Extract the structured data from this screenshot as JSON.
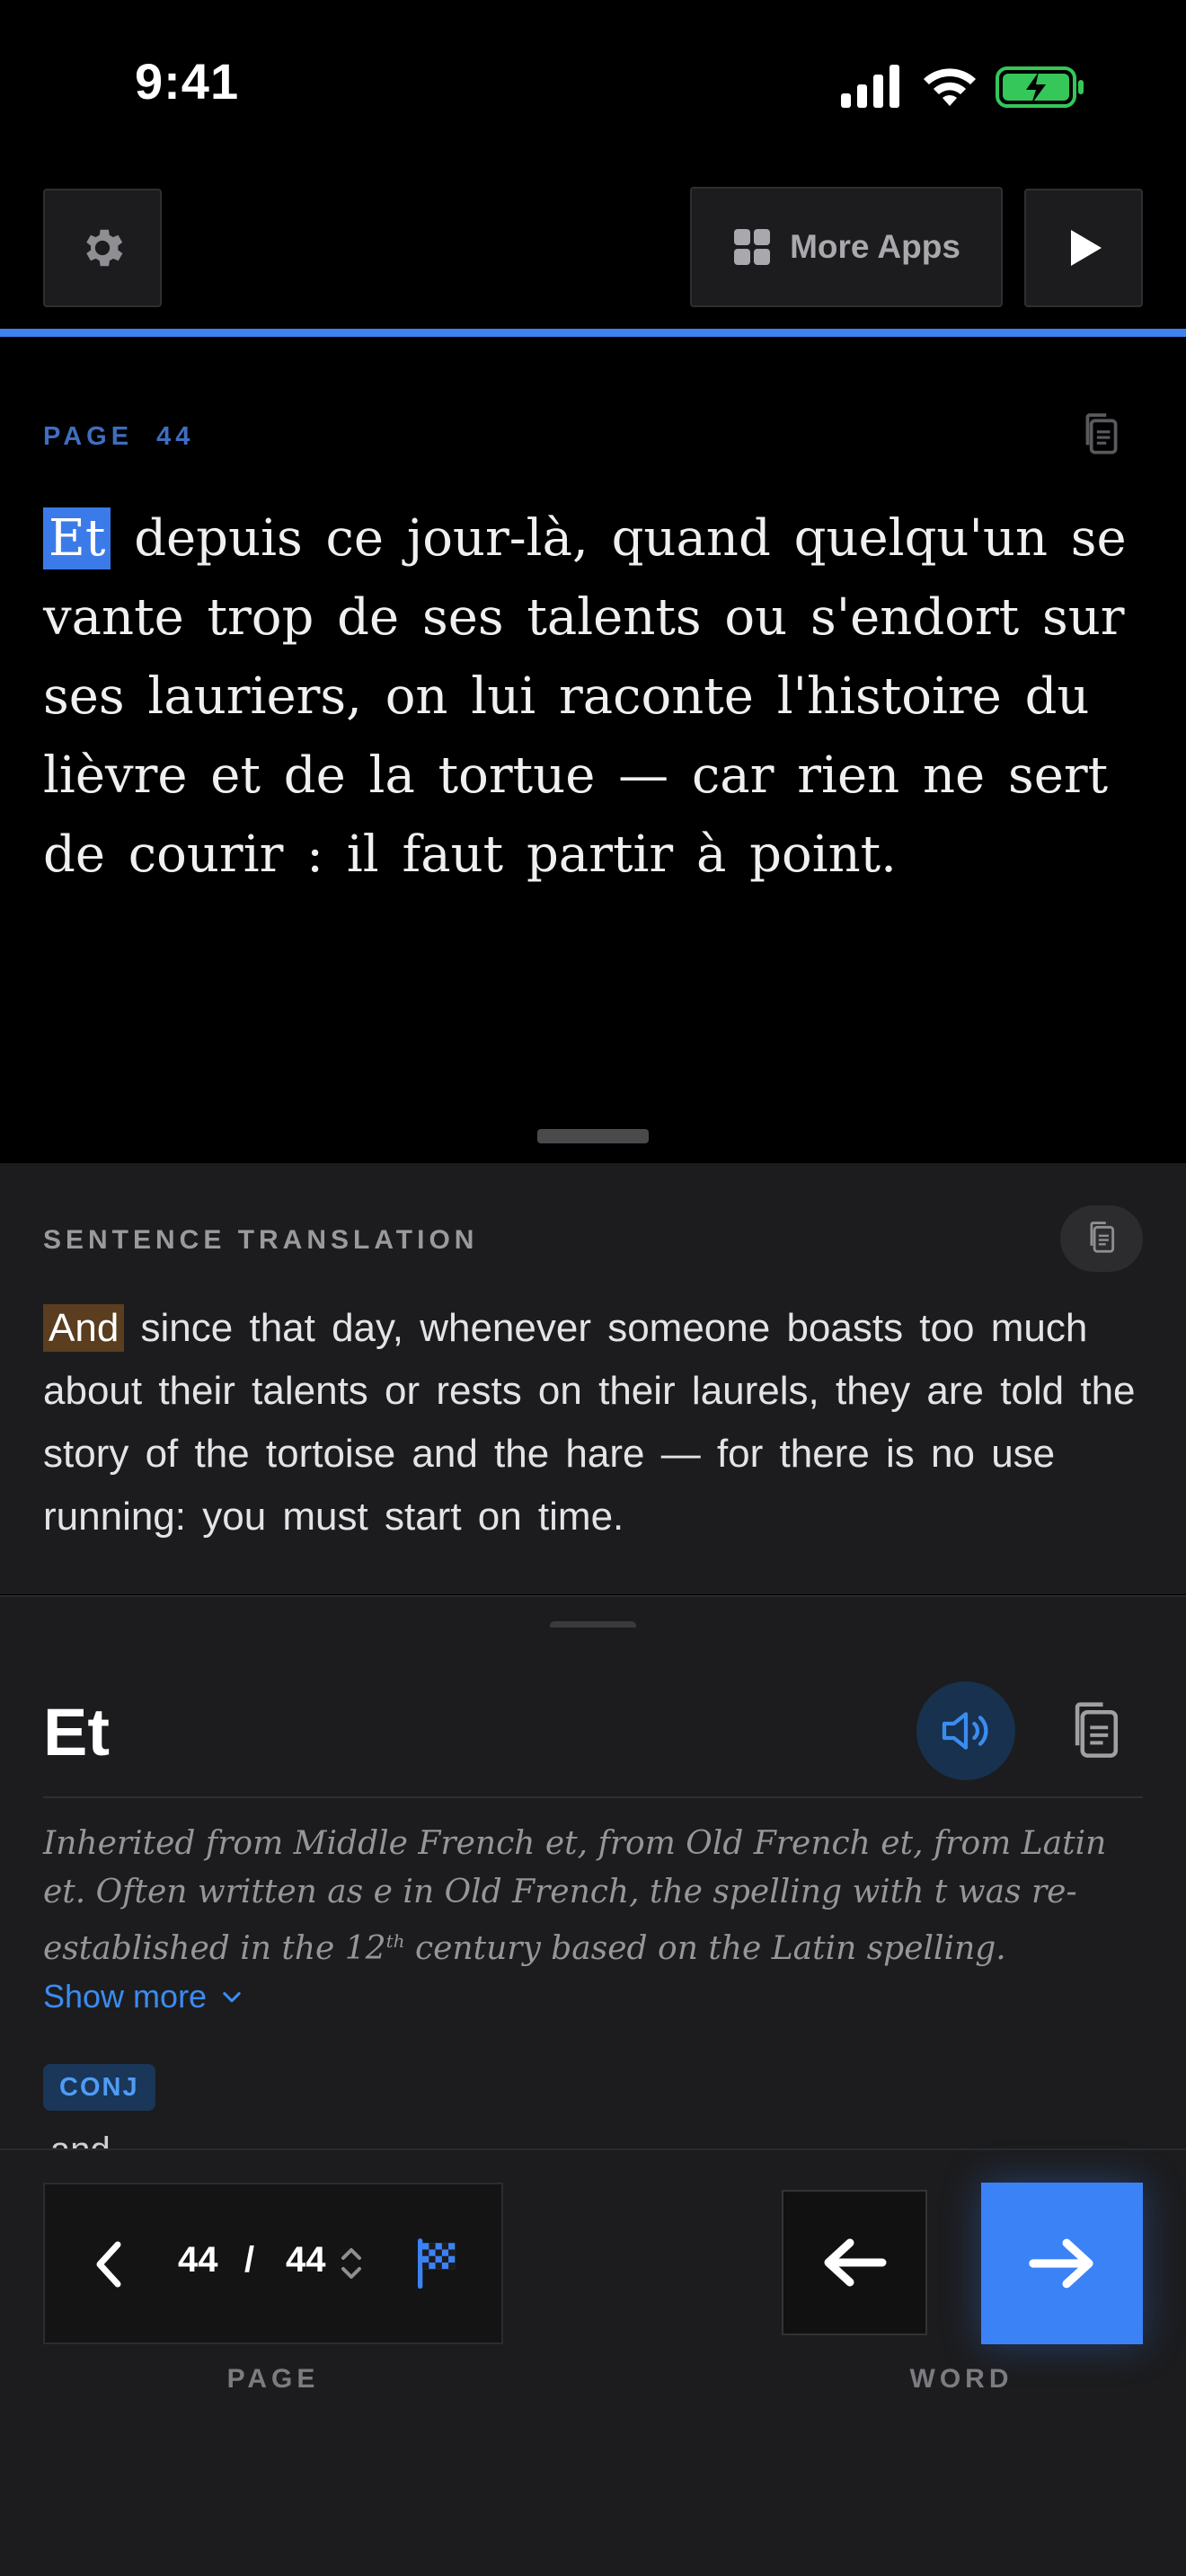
{
  "status_bar": {
    "time": "9:41"
  },
  "toolbar": {
    "settings_icon": "gear-icon",
    "more_apps_label": "More Apps",
    "more_apps_icon": "grid-icon",
    "play_icon": "play-icon",
    "accent_color": "#3d82f0"
  },
  "page": {
    "label": "PAGE  44",
    "highlighted_word": "Et",
    "text_rest": " depuis ce jour-là, quand quelqu'un se vante trop de ses talents ou s'endort sur ses lauriers, on lui raconte l'histoire du lièvre et de la tortue — car rien ne sert de courir : il faut partir à point."
  },
  "translation": {
    "label": "SENTENCE TRANSLATION",
    "highlighted_word": "And",
    "text_rest": " since that day, whenever someone boasts too much about their talents or rests on their laurels, they are told the story of the tortoise and the hare — for there is no use running: you must start on time."
  },
  "word": {
    "title": "Et",
    "etymology_part1": "Inherited from Middle French et, from Old French et, from Latin et. Often written as e in Old French, the spelling with t was re-established in the 12",
    "etymology_sup": "th",
    "etymology_part2": " century based on the Latin spelling.",
    "show_more_label": "Show more",
    "pos_badge": "CONJ",
    "cut_off_text": "and"
  },
  "navigation": {
    "current_page": "44",
    "separator": "/",
    "total_pages": "44",
    "page_caption": "PAGE",
    "word_caption": "WORD",
    "flag_icon": "checkered-flag-icon"
  }
}
